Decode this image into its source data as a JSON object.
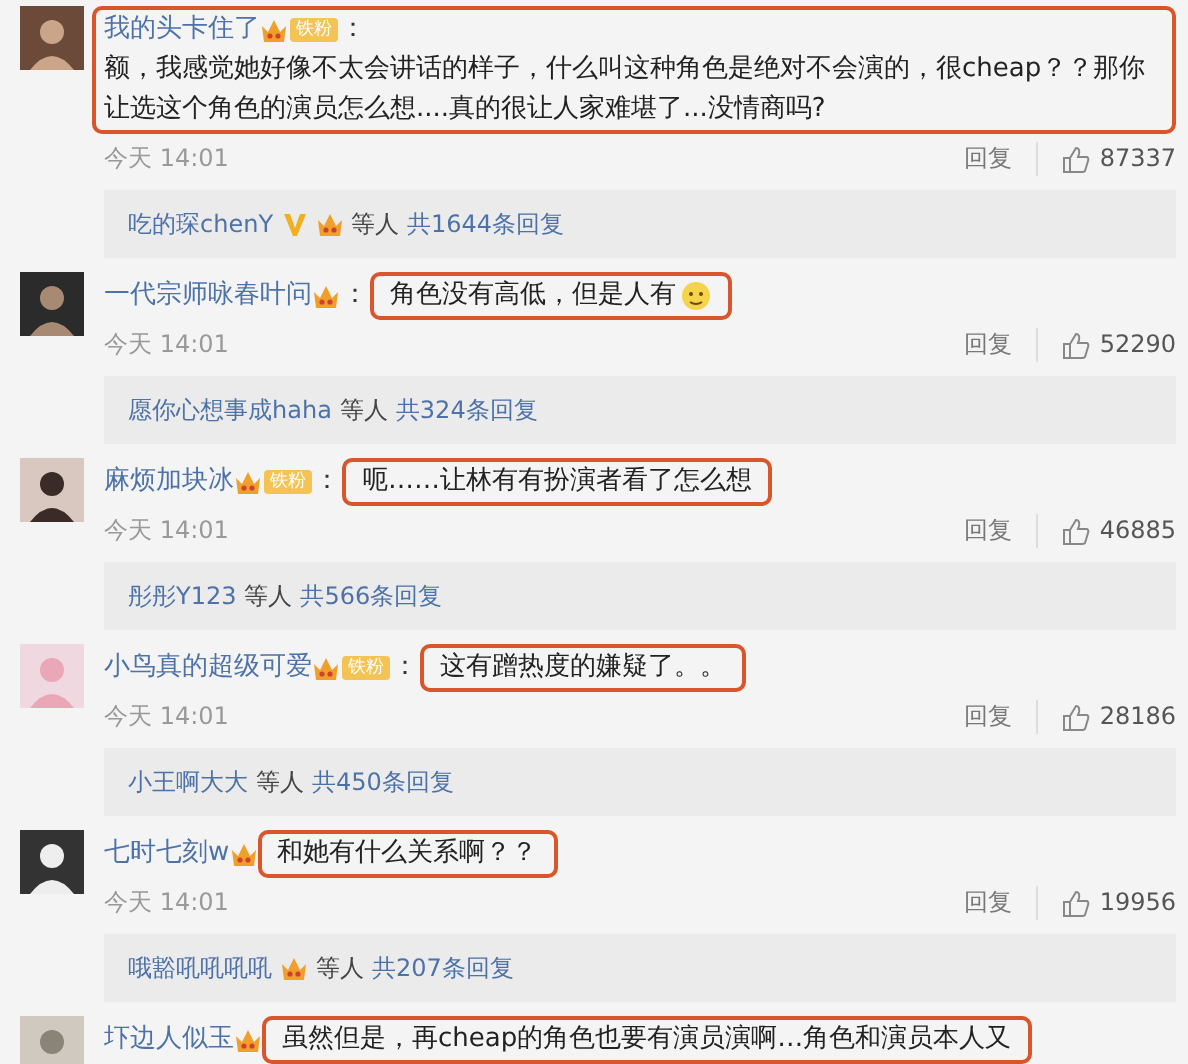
{
  "comments": [
    {
      "username": "我的头卡住了",
      "crown_badge": true,
      "fan_label": "铁粉",
      "separator": "：",
      "text": "额，我感觉她好像不太会讲话的样子，什么叫这种角色是绝对不会演的，很cheap？？那你让选这个角色的演员怎么想....真的很让人家难堪了...没情商吗?",
      "highlighted": true,
      "highlight_includes_name": true,
      "time": "今天 14:01",
      "reply_label": "回复",
      "likes": "87337",
      "replies": {
        "name": "吃的琛chenY",
        "verified": true,
        "crown": true,
        "others": "等人",
        "count": "共1644条回复"
      }
    },
    {
      "username": "一代宗师咏春叶问",
      "crown_badge": true,
      "separator": "：",
      "text": "角色没有高低，但是人有",
      "emoji": true,
      "highlighted": true,
      "highlight_includes_name": false,
      "time": "今天 14:01",
      "reply_label": "回复",
      "likes": "52290",
      "replies": {
        "name": "愿你心想事成haha",
        "verified": false,
        "crown": false,
        "others": "等人",
        "count": "共324条回复"
      }
    },
    {
      "username": "麻烦加块冰",
      "crown_badge": true,
      "fan_label": "铁粉",
      "separator": "：",
      "text": "呃……让林有有扮演者看了怎么想",
      "highlighted": true,
      "highlight_includes_name": false,
      "time": "今天 14:01",
      "reply_label": "回复",
      "likes": "46885",
      "replies": {
        "name": "彤彤Y123",
        "verified": false,
        "crown": false,
        "others": "等人",
        "count": "共566条回复"
      }
    },
    {
      "username": "小鸟真的超级可爱",
      "crown_badge": true,
      "fan_label": "铁粉",
      "separator": "：",
      "text": "这有蹭热度的嫌疑了。。",
      "highlighted": true,
      "highlight_includes_name": false,
      "time": "今天 14:01",
      "reply_label": "回复",
      "likes": "28186",
      "replies": {
        "name": "小王啊大大",
        "verified": false,
        "crown": false,
        "others": "等人",
        "count": "共450条回复"
      }
    },
    {
      "username": "七时七刻w",
      "crown_badge": true,
      "text": "和她有什么关系啊？？",
      "highlighted": true,
      "highlight_includes_name": false,
      "time": "今天 14:01",
      "reply_label": "回复",
      "likes": "19956",
      "replies": {
        "name": "哦豁吼吼吼吼",
        "verified": false,
        "crown": true,
        "others": "等人",
        "count": "共207条回复"
      }
    },
    {
      "username": "圷边人似玉",
      "crown_badge": true,
      "text": "虽然但是，再cheap的角色也要有演员演啊…角色和演员本人又",
      "highlighted": true,
      "highlight_includes_name": false
    }
  ]
}
